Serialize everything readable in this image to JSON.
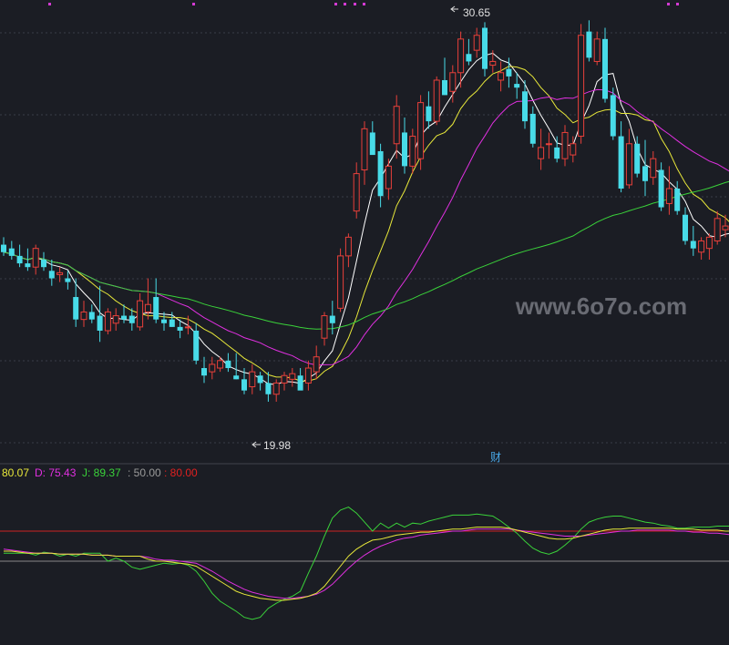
{
  "chart_data": [
    {
      "type": "candlestick",
      "annotations": {
        "high_label": "30.65",
        "low_label": "19.98",
        "event_label": "财",
        "watermark": "www.6o7o.com"
      },
      "colors": {
        "up": "#e8403a",
        "down": "#48dbe8",
        "ma_white": "#ffffff",
        "ma_yellow": "#e8e83a",
        "ma_magenta": "#e030e0",
        "ma_green": "#3ad23a",
        "grid": "#3a3d47"
      },
      "price_axis": {
        "min": 19.5,
        "max": 31.0
      },
      "candles": [
        [
          24.7,
          24.9,
          24.4,
          24.5
        ],
        [
          24.6,
          24.8,
          24.3,
          24.4
        ],
        [
          24.4,
          24.7,
          24.1,
          24.2
        ],
        [
          24.2,
          24.6,
          24.0,
          24.1
        ],
        [
          24.1,
          24.7,
          23.9,
          24.6
        ],
        [
          24.3,
          24.5,
          24.0,
          24.1
        ],
        [
          24.0,
          24.3,
          23.6,
          23.8
        ],
        [
          23.9,
          24.1,
          23.7,
          23.95
        ],
        [
          23.8,
          24.0,
          23.5,
          23.7
        ],
        [
          23.3,
          23.8,
          22.5,
          22.7
        ],
        [
          22.7,
          23.2,
          22.5,
          22.9
        ],
        [
          22.9,
          23.1,
          22.6,
          22.7
        ],
        [
          22.8,
          23.6,
          22.1,
          22.4
        ],
        [
          22.4,
          23.0,
          22.3,
          22.9
        ],
        [
          22.6,
          23.0,
          22.4,
          22.8
        ],
        [
          22.8,
          23.1,
          22.6,
          22.7
        ],
        [
          22.8,
          23.0,
          22.4,
          22.6
        ],
        [
          22.5,
          23.4,
          22.4,
          23.2
        ],
        [
          22.9,
          23.8,
          22.7,
          23.1
        ],
        [
          23.3,
          23.8,
          22.6,
          22.7
        ],
        [
          22.7,
          22.9,
          22.4,
          22.6
        ],
        [
          22.7,
          22.9,
          22.5,
          22.5
        ],
        [
          22.5,
          22.7,
          22.2,
          22.4
        ],
        [
          22.5,
          22.8,
          22.3,
          22.5
        ],
        [
          22.4,
          22.6,
          21.5,
          21.6
        ],
        [
          21.4,
          21.7,
          21.0,
          21.2
        ],
        [
          21.3,
          21.7,
          21.1,
          21.5
        ],
        [
          21.4,
          21.7,
          21.3,
          21.6
        ],
        [
          21.6,
          21.8,
          21.3,
          21.4
        ],
        [
          21.2,
          21.8,
          21.1,
          21.1
        ],
        [
          21.1,
          21.4,
          20.7,
          20.8
        ],
        [
          20.9,
          21.5,
          20.7,
          21.3
        ],
        [
          21.2,
          21.3,
          20.8,
          21.0
        ],
        [
          21.0,
          21.3,
          20.5,
          20.7
        ],
        [
          20.7,
          21.1,
          20.5,
          21.0
        ],
        [
          21.0,
          21.3,
          20.8,
          21.2
        ],
        [
          21.1,
          21.4,
          20.9,
          21.25
        ],
        [
          21.2,
          21.4,
          20.9,
          20.8
        ],
        [
          21.0,
          21.6,
          20.8,
          21.4
        ],
        [
          21.3,
          22.0,
          21.1,
          21.7
        ],
        [
          22.2,
          22.9,
          22.0,
          22.8
        ],
        [
          22.8,
          23.2,
          22.3,
          22.6
        ],
        [
          23.0,
          24.6,
          22.9,
          24.4
        ],
        [
          24.4,
          25.0,
          24.1,
          24.9
        ],
        [
          25.6,
          26.9,
          25.4,
          26.6
        ],
        [
          26.7,
          28.0,
          26.3,
          27.8
        ],
        [
          27.7,
          28.0,
          27.3,
          27.1
        ],
        [
          27.2,
          27.4,
          25.7,
          26.0
        ],
        [
          26.2,
          27.0,
          25.9,
          26.8
        ],
        [
          27.4,
          28.7,
          27.0,
          28.4
        ],
        [
          27.7,
          28.1,
          26.6,
          26.8
        ],
        [
          26.8,
          27.8,
          26.6,
          27.6
        ],
        [
          27.0,
          28.7,
          26.7,
          28.5
        ],
        [
          28.4,
          28.8,
          27.8,
          28.0
        ],
        [
          28.0,
          29.2,
          27.9,
          29.1
        ],
        [
          29.1,
          29.7,
          28.7,
          28.7
        ],
        [
          28.8,
          29.5,
          28.5,
          29.3
        ],
        [
          29.3,
          30.4,
          28.9,
          30.2
        ],
        [
          29.8,
          30.2,
          29.5,
          29.6
        ],
        [
          29.9,
          30.5,
          29.7,
          30.3
        ],
        [
          30.5,
          30.65,
          29.2,
          29.4
        ],
        [
          29.5,
          29.9,
          29.3,
          29.6
        ],
        [
          29.1,
          29.6,
          28.8,
          29.3
        ],
        [
          29.4,
          29.7,
          28.9,
          29.2
        ],
        [
          29.0,
          29.3,
          28.6,
          28.9
        ],
        [
          28.8,
          29.1,
          27.8,
          28.0
        ],
        [
          28.2,
          28.4,
          27.3,
          27.4
        ],
        [
          27.0,
          27.8,
          26.7,
          27.3
        ],
        [
          27.4,
          27.7,
          27.0,
          27.4
        ],
        [
          27.3,
          27.6,
          26.9,
          27.0
        ],
        [
          27.0,
          27.9,
          26.8,
          27.7
        ],
        [
          27.1,
          27.6,
          26.9,
          27.4
        ],
        [
          27.6,
          30.6,
          27.4,
          30.3
        ],
        [
          30.4,
          30.7,
          29.6,
          29.7
        ],
        [
          29.6,
          30.4,
          29.5,
          30.2
        ],
        [
          30.2,
          30.5,
          28.5,
          28.6
        ],
        [
          28.7,
          28.9,
          27.5,
          27.6
        ],
        [
          27.6,
          28.0,
          26.1,
          26.2
        ],
        [
          26.3,
          27.8,
          26.2,
          27.4
        ],
        [
          27.4,
          27.6,
          26.5,
          26.6
        ],
        [
          26.8,
          27.5,
          26.0,
          26.4
        ],
        [
          26.5,
          27.2,
          26.3,
          27.0
        ],
        [
          26.7,
          26.9,
          25.6,
          25.7
        ],
        [
          25.8,
          26.8,
          25.5,
          26.2
        ],
        [
          26.2,
          26.4,
          25.5,
          25.6
        ],
        [
          25.5,
          25.7,
          24.7,
          24.8
        ],
        [
          24.8,
          25.2,
          24.4,
          24.6
        ],
        [
          24.5,
          24.9,
          24.3,
          24.8
        ],
        [
          24.6,
          25.0,
          24.3,
          24.9
        ],
        [
          24.8,
          25.6,
          24.7,
          25.4
        ],
        [
          25.1,
          25.5,
          24.9,
          25.2
        ],
        [
          25.0,
          25.4,
          24.6,
          24.8
        ]
      ]
    },
    {
      "type": "line",
      "indicator": "KDJ",
      "legend": {
        "k_label": "80.07",
        "d_label": "D: 75.43",
        "j_label": "J: 89.37",
        "ref1_label": ": 50.00",
        "ref2_label": ": 80.00"
      },
      "colors": {
        "k": "#e8e83a",
        "d": "#e030e0",
        "j": "#3ad23a",
        "ref50": "#888888",
        "ref80": "#cc2222"
      },
      "y_range": [
        -30,
        130
      ],
      "reference_lines": [
        50,
        80
      ],
      "series": [
        {
          "key": "K",
          "values": [
            60,
            60,
            59,
            58,
            58,
            58,
            58,
            57,
            57,
            57,
            57,
            56,
            56,
            56,
            55,
            55,
            55,
            55,
            52,
            50,
            50,
            49,
            48,
            47,
            45,
            40,
            35,
            30,
            25,
            20,
            17,
            15,
            13,
            12,
            11,
            11,
            12,
            13,
            15,
            18,
            25,
            35,
            45,
            55,
            62,
            67,
            71,
            72,
            74,
            76,
            77,
            78,
            79,
            79,
            80,
            81,
            82,
            82,
            83,
            84,
            84,
            84,
            84,
            83,
            81,
            79,
            77,
            75,
            73,
            72,
            72,
            73,
            75,
            77,
            79,
            81,
            82,
            82,
            83,
            83,
            83,
            83,
            83,
            83,
            82,
            82,
            82,
            81,
            81,
            81,
            80,
            80
          ]
        },
        {
          "key": "D",
          "values": [
            62,
            61,
            60,
            59,
            58,
            58,
            58,
            57,
            57,
            57,
            57,
            56,
            56,
            56,
            55,
            55,
            55,
            55,
            54,
            52,
            51,
            51,
            50,
            49,
            48,
            44,
            40,
            35,
            30,
            26,
            22,
            19,
            17,
            15,
            14,
            13,
            13,
            14,
            15,
            17,
            21,
            27,
            35,
            43,
            50,
            56,
            61,
            65,
            68,
            71,
            73,
            74,
            76,
            77,
            78,
            79,
            80,
            80,
            81,
            82,
            82,
            82,
            82,
            82,
            81,
            80,
            79,
            78,
            77,
            76,
            75,
            75,
            75,
            76,
            77,
            78,
            79,
            80,
            80,
            81,
            81,
            81,
            81,
            81,
            80,
            80,
            79,
            79,
            78,
            78,
            77,
            76
          ]
        },
        {
          "key": "J",
          "values": [
            58,
            58,
            58,
            58,
            56,
            59,
            58,
            55,
            57,
            55,
            58,
            58,
            58,
            50,
            53,
            50,
            44,
            42,
            44,
            46,
            48,
            47,
            48,
            46,
            40,
            30,
            18,
            10,
            5,
            0,
            -6,
            -8,
            -6,
            3,
            8,
            12,
            15,
            20,
            38,
            55,
            75,
            93,
            101,
            104,
            98,
            89,
            80,
            88,
            83,
            88,
            84,
            88,
            87,
            90,
            92,
            94,
            96,
            96,
            96,
            97,
            96,
            95,
            90,
            84,
            78,
            70,
            63,
            59,
            57,
            60,
            66,
            73,
            82,
            89,
            92,
            94,
            95,
            95,
            93,
            91,
            89,
            88,
            86,
            85,
            83,
            83,
            84,
            84,
            84,
            85,
            85,
            85
          ]
        }
      ]
    }
  ]
}
